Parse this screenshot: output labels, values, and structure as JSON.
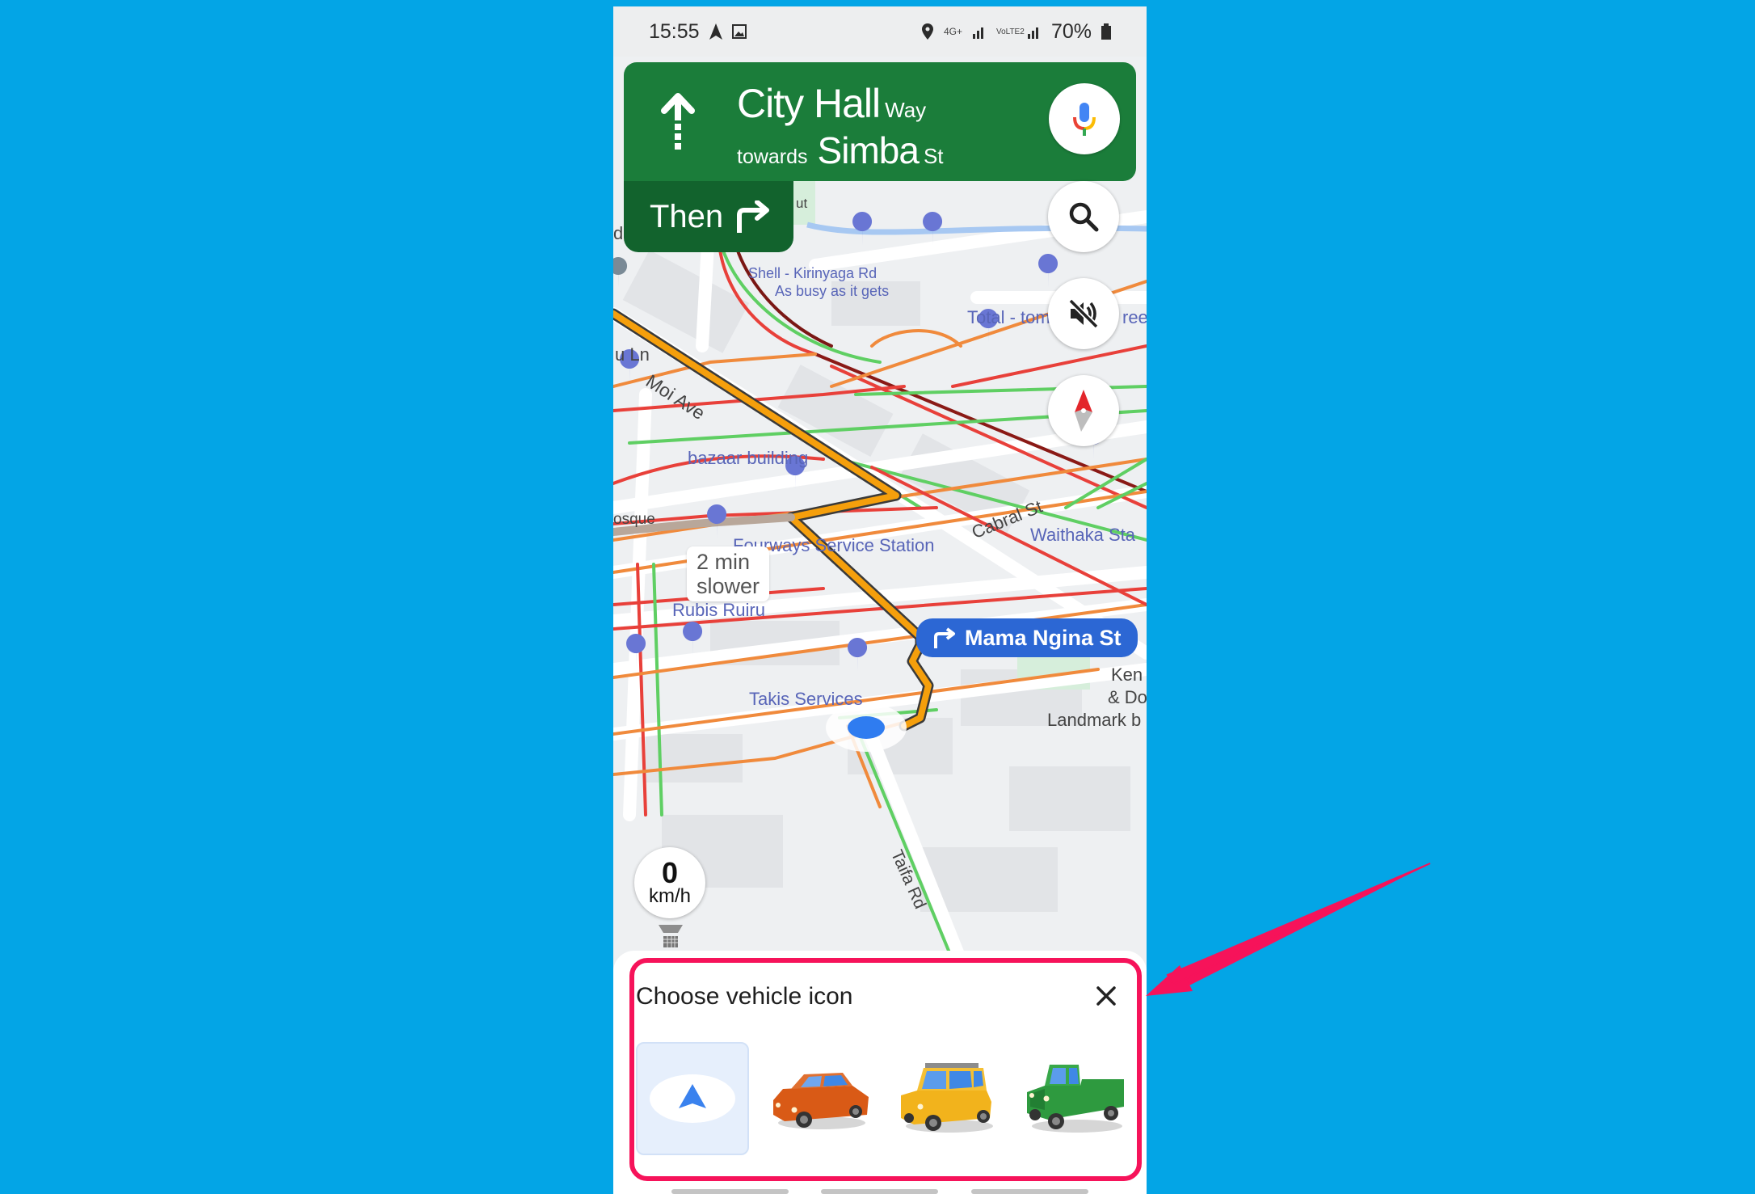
{
  "status_bar": {
    "time": "15:55",
    "network": "4G+",
    "volte": "VoLTE2",
    "battery": "70%"
  },
  "navigation": {
    "street_main": "City Hall",
    "street_main_suffix": "Way",
    "towards_label": "towards",
    "towards_street": "Simba",
    "towards_street_suffix": "St",
    "then_label": "Then",
    "next_turn": "Mama Ngina St"
  },
  "map": {
    "traffic_callout_line1": "2 min",
    "traffic_callout_line2": "slower",
    "labels": {
      "shell": "Shell - Kirinyaga Rd",
      "shell_sub": "As busy as it gets",
      "total": "Total - tom",
      "street_edge": "reet",
      "moi_ave": "Moi Ave",
      "ln": "u Ln",
      "bazaar": "bazaar building",
      "mosque": "osque",
      "fourways": "Fourways Service Station",
      "cabral": "Cabral St",
      "waithaka": "Waithaka Sta",
      "rubis": "Rubis Ruiru",
      "takis": "Takis Services",
      "taifa": "Taifa Rd",
      "kenya_l1": "Ken",
      "kenya_l2": "& Do",
      "landmark": "Landmark b",
      "ut": "ut",
      "d": "d",
      "edge_e": "e",
      "edge_s": "s"
    },
    "speed_value": "0",
    "speed_unit": "km/h"
  },
  "sheet": {
    "title": "Choose vehicle icon",
    "options": [
      {
        "name": "Navigation arrow",
        "selected": true
      },
      {
        "name": "Red car",
        "selected": false
      },
      {
        "name": "Yellow SUV",
        "selected": false
      },
      {
        "name": "Green pickup truck",
        "selected": false
      }
    ]
  },
  "colors": {
    "background": "#03a5e6",
    "nav_green": "#1b7d3a",
    "then_green": "#12632d",
    "highlight": "#f6135a",
    "turn_blue": "#2c67d4",
    "route_orange": "#f59f0c",
    "location_blue": "#2f7cf0"
  }
}
